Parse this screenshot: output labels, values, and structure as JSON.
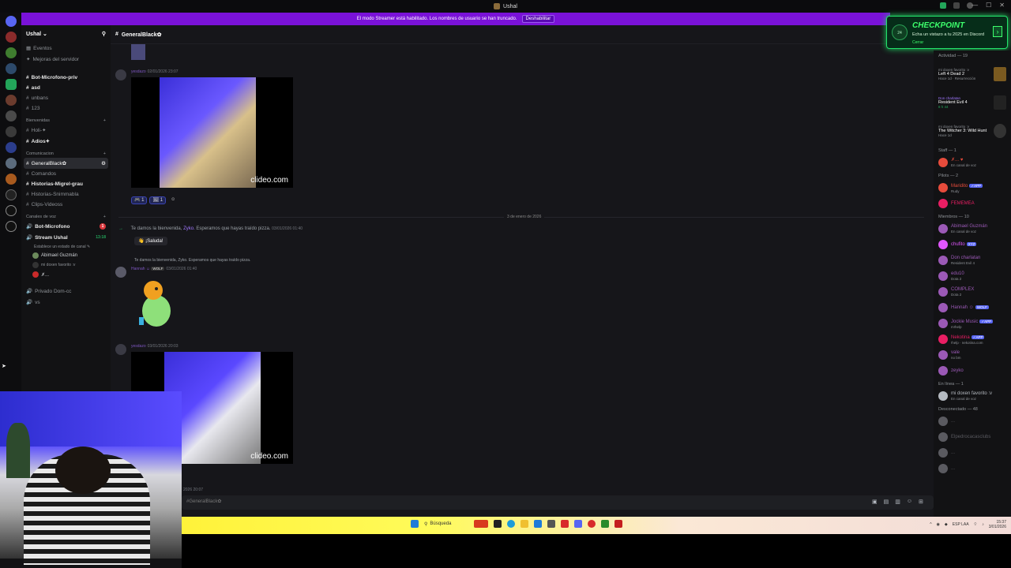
{
  "window": {
    "title": "Ushal"
  },
  "banner": {
    "text": "El modo Streamer está habilitado. Los nombres de usuario se han truncado.",
    "button": "Deshabilitar"
  },
  "guild": {
    "name": "Ushal ⌄"
  },
  "channels": {
    "events": "Eventos",
    "boosts": "Mejoras del servidor",
    "items": [
      {
        "label": "Bot-Microfono-priv",
        "bold": true
      },
      {
        "label": "asd",
        "bold": true
      },
      {
        "label": "unbans",
        "bold": false
      },
      {
        "label": "123",
        "bold": false
      }
    ],
    "cat_welcome": "Bienvenidas",
    "welcome_items": [
      {
        "label": "Holi-✦"
      },
      {
        "label": "Adios✦"
      }
    ],
    "cat_comms": "Comunicacion",
    "comms_items": [
      {
        "label": "GeneralBlack✿",
        "selected": true
      },
      {
        "label": "Comandos"
      },
      {
        "label": "Historias-Migrel-grau"
      },
      {
        "label": "Historias-Snimmabla"
      },
      {
        "label": "Clips-Videoss"
      }
    ],
    "cat_voice": "Canales de voz",
    "voice_items": [
      {
        "label": "Bot-Microfono",
        "badge": "1"
      },
      {
        "label": "Stream Ushal",
        "time": "13:18"
      }
    ],
    "voice_status": "Establece un estado de canal ✎",
    "voice_users": [
      "Abimael Guzmán",
      "mi doxen favorito :v",
      "✗..."
    ],
    "more": [
      {
        "label": "Privado Dom-cc"
      },
      {
        "label": "vs"
      }
    ]
  },
  "chat": {
    "channel_name": "GeneralBlack✿",
    "msg1_author": "yesdazo",
    "msg1_time": "02/01/2026 23:07",
    "watermark": "clideo.com",
    "reactions": [
      "🎮 1",
      "🖼 1"
    ],
    "date_divider": "3 de enero de 2026",
    "sys1_pre": "Te damos la bienvenida,",
    "sys1_name": "Zyko.",
    "sys1_post": "Esperamos que hayas traído pizza.",
    "sys1_extra": "03/01/2026 01:40",
    "sys1_reply": "¡Saluda!",
    "reply_text": "Te damos la bienvenida, Zyko. Esperamos que hayas traído pizza.",
    "msg2_author": "Hannah ☺",
    "msg2_tag": "WOLF",
    "msg2_time": "03/01/2026 01:40",
    "msg3_author": "yesdazo",
    "msg3_time": "03/01/2026 20:03",
    "input_hint": "#GeneralBlack✿",
    "input_sub": "2026 20:07"
  },
  "checkpoint": {
    "title": "CHECKPOINT",
    "desc": "Echa un vistazo a tu 2025 en Discord",
    "close": "Cerrar",
    "logo": "24"
  },
  "members": {
    "activity_header": "Actividad — 19",
    "activities": [
      {
        "user": "mi doxen favorito :v",
        "game": "Left 4 Dead 2",
        "sub": "Hace 1d · Resurrección"
      },
      {
        "user": "Don charlatan",
        "game": "Resident Evil 4",
        "sub": "8 h 44"
      },
      {
        "user": "mi doxen favorito :v",
        "game": "The Witcher 3: Wild Hunt",
        "sub": "Hace 1d"
      }
    ],
    "groups": [
      {
        "header": "Staff — 1",
        "items": [
          {
            "name": "✗... ♥",
            "status": "En canal de voz",
            "color": "#e74c3c"
          }
        ]
      },
      {
        "header": "Pilots — 2",
        "items": [
          {
            "name": "Maridito",
            "status": "Rudy",
            "color": "#e74c3c",
            "tag": "✓APP"
          },
          {
            "name": "FEMEMEA",
            "status": "",
            "color": "#e91e63"
          }
        ]
      },
      {
        "header": "Miembros — 10",
        "items": [
          {
            "name": "Abimael Guzmán",
            "status": "En canal de voz",
            "color": "#9b59b6"
          },
          {
            "name": "chufito",
            "status": "",
            "color": "#e056fd",
            "tag": "XYZ"
          },
          {
            "name": "Don charlatan",
            "status": "Resident Evil 4",
            "color": "#9b59b6"
          },
          {
            "name": "edu10",
            "status": "Dota 2",
            "color": "#9b59b6"
          },
          {
            "name": "COMPLEX",
            "status": "Dota 2",
            "color": "#9b59b6"
          },
          {
            "name": "Hannah ☺",
            "status": "",
            "color": "#9b59b6",
            "tag": "WOLF"
          },
          {
            "name": "Jockie Music",
            "status": "m!help",
            "color": "#9b59b6",
            "tag": "✓APP"
          },
          {
            "name": "Nekotina",
            "status": "!help · nekotina.com",
            "color": "#e91e63",
            "tag": "✓APP"
          },
          {
            "name": "vale",
            "status": "no bm",
            "color": "#9b59b6"
          },
          {
            "name": "zeyko",
            "status": "",
            "color": "#9b59b6"
          }
        ]
      },
      {
        "header": "En línea — 1",
        "items": [
          {
            "name": "mi doxen favorito :v",
            "status": "En canal de voz",
            "color": "#b5bac1"
          }
        ]
      },
      {
        "header": "Desconectado — 48",
        "items": [
          {
            "name": "...",
            "status": "",
            "color": "#5a5a60"
          },
          {
            "name": "Elpedrocacasclubs",
            "status": "",
            "color": "#5a5a60"
          },
          {
            "name": "...",
            "status": "",
            "color": "#5a5a60"
          },
          {
            "name": "...",
            "status": "",
            "color": "#5a5a60"
          }
        ]
      }
    ]
  },
  "taskbar": {
    "search": "Búsqueda",
    "lang": "ESP LAA",
    "time": "15:37",
    "date": "3/01/2026"
  },
  "colors": {
    "accent": "#7a12d8",
    "checkpoint": "#3dff6c"
  }
}
